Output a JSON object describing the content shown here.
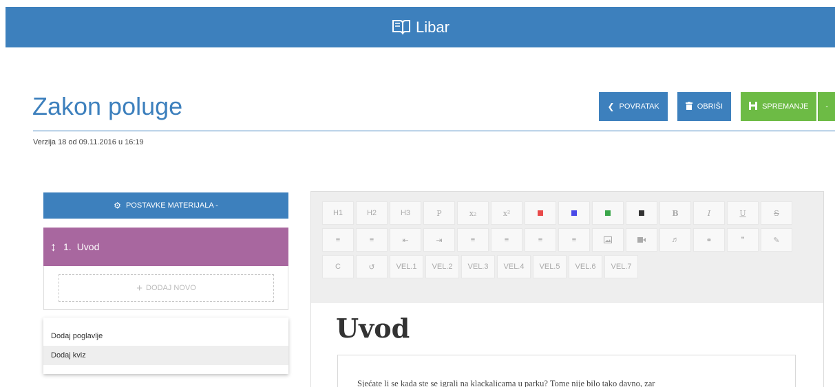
{
  "header": {
    "brand": "Libar",
    "logo_icon": "book-icon"
  },
  "page": {
    "title": "Zakon poluge",
    "version": "Verzija 18 od 09.11.2016 u 16:19"
  },
  "actions": {
    "back": {
      "label": "POVRATAK",
      "icon": "chevron-left-icon"
    },
    "delete": {
      "label": "OBRIŠI",
      "icon": "trash-icon"
    },
    "save": {
      "label": "SPREMANJE",
      "icon": "save-icon"
    },
    "save_caret": "-"
  },
  "sidebar": {
    "settings_label": "POSTAVKE MATERIJALA -",
    "chapter": {
      "number": "1.",
      "title": "Uvod"
    },
    "add_new": "DODAJ NOVO",
    "dropdown": [
      "Dodaj poglavlje",
      "Dodaj kviz"
    ]
  },
  "toolbar": {
    "row1": [
      "H1",
      "H2",
      "H3",
      "P",
      "x₂",
      "x²",
      "red",
      "blue",
      "green",
      "black",
      "B",
      "I",
      "U",
      "S"
    ],
    "row1_colors": {
      "red": "#e84a4a",
      "blue": "#4a4ae8",
      "green": "#3aa64a",
      "black": "#333333"
    },
    "row2_icons": [
      "bullet-list-icon",
      "numbered-list-icon",
      "outdent-icon",
      "indent-icon",
      "align-left-icon",
      "align-center-icon",
      "align-right-icon",
      "justify-icon",
      "image-icon",
      "video-icon",
      "audio-icon",
      "link-icon",
      "quote-icon",
      "clear-format-icon"
    ],
    "row3": [
      "C",
      "↺",
      "VEL.1",
      "VEL.2",
      "VEL.3",
      "VEL.4",
      "VEL.5",
      "VEL.6",
      "VEL.7"
    ]
  },
  "document": {
    "heading": "Uvod",
    "text": "Sjećate li se kada ste se igrali na klackalicama u parku? Tome nije bilo tako davno, zar"
  },
  "colors": {
    "primary": "#3d80bd",
    "success": "#6dbb45",
    "chapter": "#a8679f"
  }
}
